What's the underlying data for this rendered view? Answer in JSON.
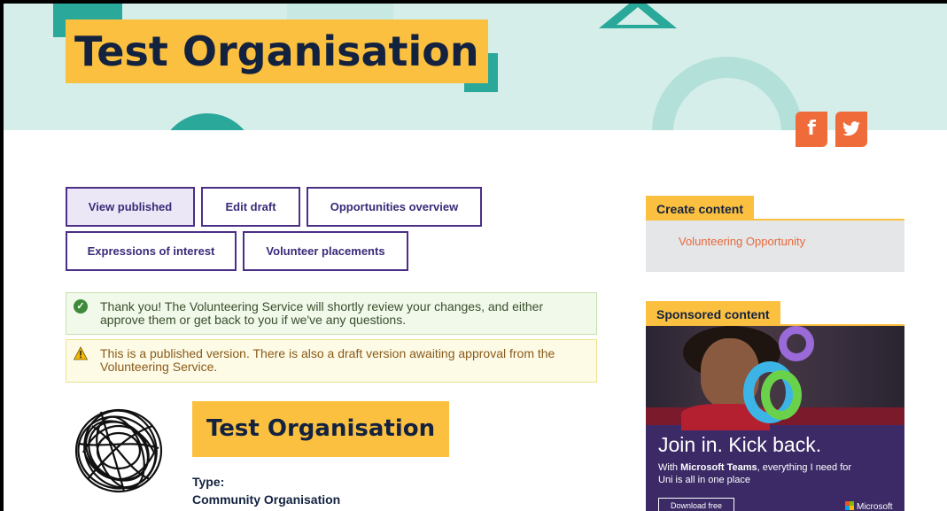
{
  "hero": {
    "title": "Test Organisation"
  },
  "social": {
    "facebook": "f",
    "twitter": "twitter"
  },
  "tabs": [
    {
      "label": "View published"
    },
    {
      "label": "Edit draft"
    },
    {
      "label": "Opportunities overview"
    },
    {
      "label": "Expressions of interest"
    },
    {
      "label": "Volunteer placements"
    }
  ],
  "alerts": {
    "success": "Thank you! The Volunteering Service will shortly review your changes, and either approve them or get back to you if we've any questions.",
    "warning": "This is a published version. There is also a draft version awaiting approval from the Volunteering Service."
  },
  "organisation": {
    "name": "Test Organisation",
    "type_label": "Type:",
    "type_value": "Community Organisation"
  },
  "sidebar": {
    "create_heading": "Create content",
    "create_link": "Volunteering Opportunity",
    "sponsored_heading": "Sponsored content",
    "ad": {
      "headline": "Join in. Kick back.",
      "body_prefix": "With ",
      "body_brand": "Microsoft Teams",
      "body_suffix": ", everything I need for Uni is all in one place",
      "cta": "Download free",
      "brand": "Microsoft"
    }
  },
  "colors": {
    "accent_yellow": "#fcc040",
    "navy": "#13223f",
    "purple": "#4b2f86",
    "teal": "#2aa89a",
    "orange": "#ef6b3a"
  }
}
